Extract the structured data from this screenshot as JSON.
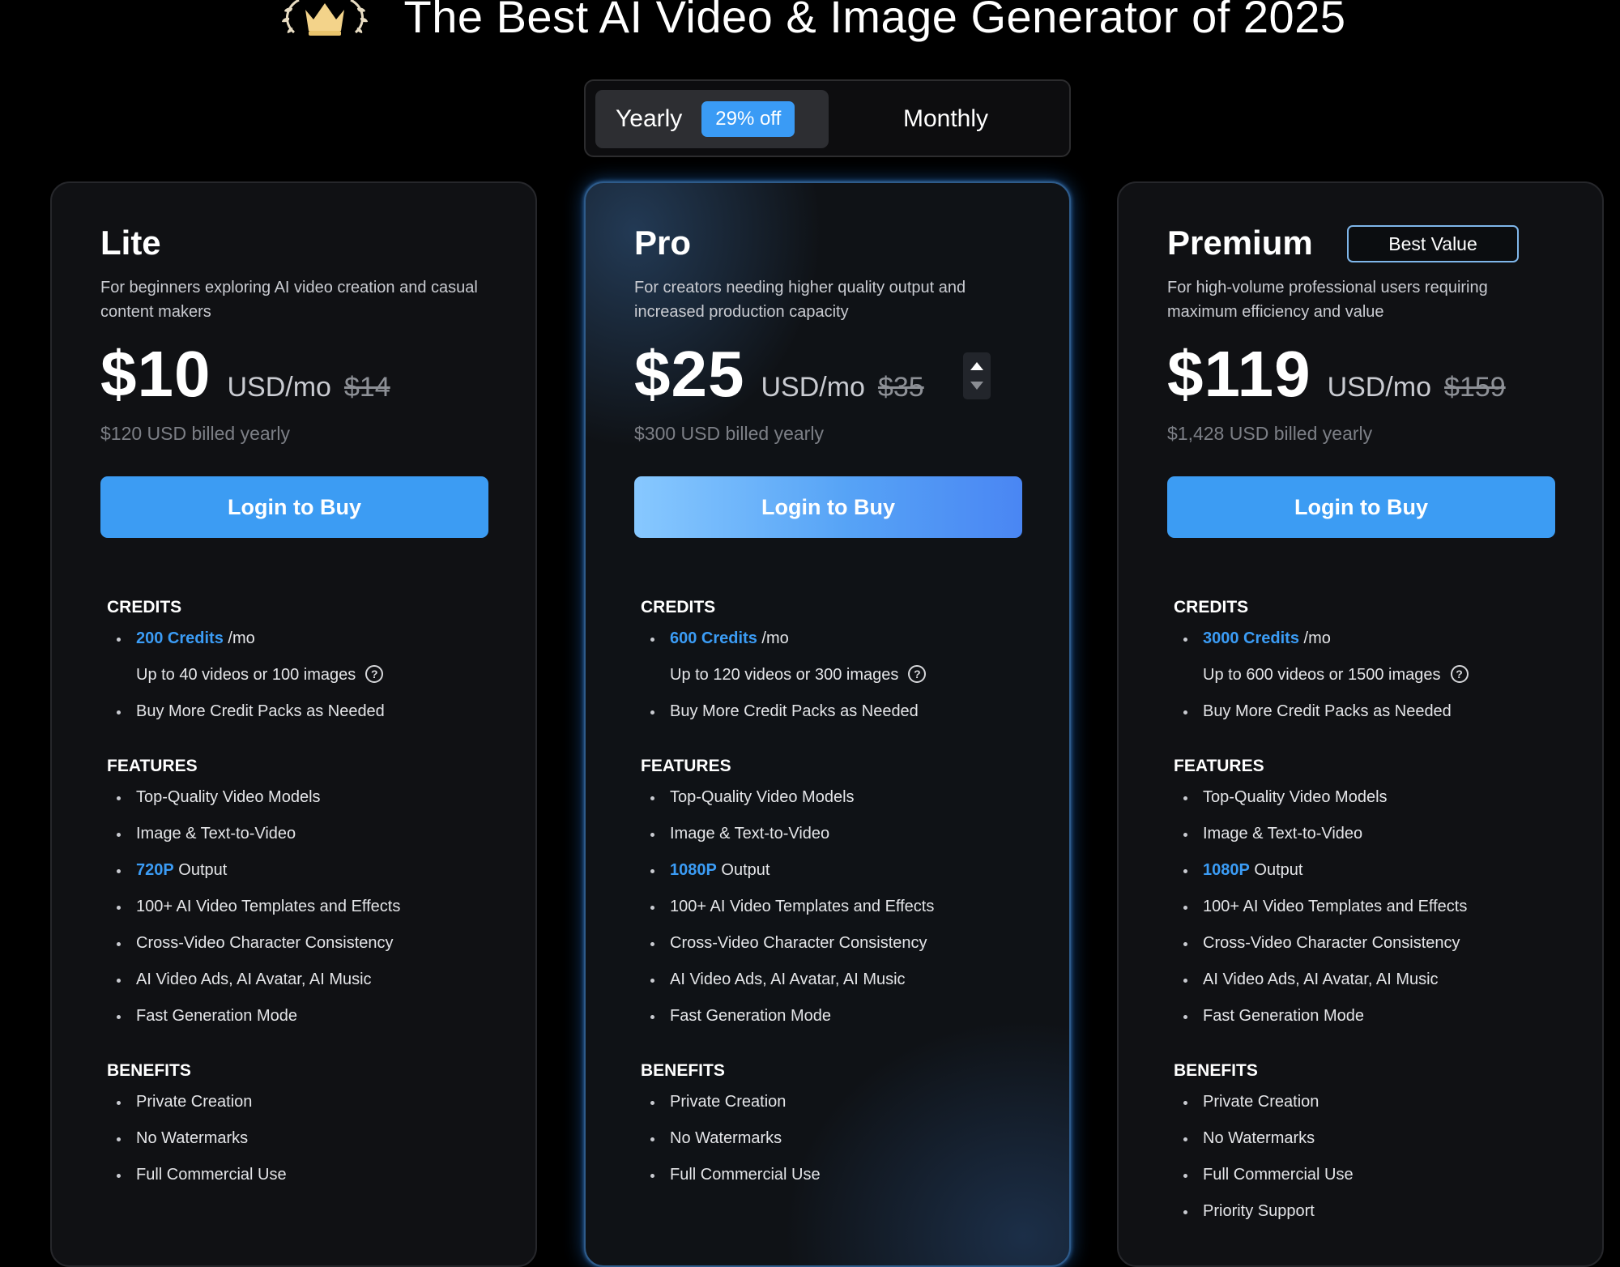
{
  "header": {
    "title": "The Best AI Video & Image Generator of 2025"
  },
  "billing_toggle": {
    "yearly_label": "Yearly",
    "discount_badge": "29% off",
    "monthly_label": "Monthly",
    "selected": "Yearly"
  },
  "colors": {
    "accent": "#3b9cf5",
    "button": "#3c9cf3",
    "background": "#000000",
    "card": "#101114"
  },
  "icons": [
    "crown-laurel-icon",
    "help-circle-icon",
    "stepper-up-icon",
    "stepper-down-icon"
  ],
  "plans": [
    {
      "name": "Lite",
      "description": "For beginners exploring AI video creation and casual content makers",
      "price": "$10",
      "unit": "USD/mo",
      "old_price": "$14",
      "billed": "$120 USD billed yearly",
      "button": "Login to Buy",
      "credits_title": "CREDITS",
      "credits_highlight": "200 Credits",
      "credits_suffix": " /mo",
      "credits_note": "Up to 40 videos or 100 images",
      "credits_more": "Buy More Credit Packs as Needed",
      "features_title": "FEATURES",
      "features": {
        "f1": "Top-Quality Video Models",
        "f2": "Image & Text-to-Video",
        "res_highlight": "720P",
        "res_suffix": " Output",
        "f4": "100+ AI Video Templates and Effects",
        "f5": "Cross-Video Character Consistency",
        "f6": "AI Video Ads, AI Avatar, AI Music",
        "f7": "Fast Generation Mode"
      },
      "benefits_title": "BENEFITS",
      "benefits": [
        "Private Creation",
        "No Watermarks",
        "Full Commercial Use"
      ]
    },
    {
      "name": "Pro",
      "description": "For creators needing higher quality output and increased production capacity",
      "price": "$25",
      "unit": "USD/mo",
      "old_price": "$35",
      "billed": "$300 USD billed yearly",
      "button": "Login to Buy",
      "credits_title": "CREDITS",
      "credits_highlight": "600 Credits",
      "credits_suffix": " /mo",
      "credits_note": "Up to 120 videos or 300 images",
      "credits_more": "Buy More Credit Packs as Needed",
      "features_title": "FEATURES",
      "features": {
        "f1": "Top-Quality Video Models",
        "f2": "Image & Text-to-Video",
        "res_highlight": "1080P",
        "res_suffix": " Output",
        "f4": "100+ AI Video Templates and Effects",
        "f5": "Cross-Video Character Consistency",
        "f6": "AI Video Ads, AI Avatar, AI Music",
        "f7": "Fast Generation Mode"
      },
      "benefits_title": "BENEFITS",
      "benefits": [
        "Private Creation",
        "No Watermarks",
        "Full Commercial Use"
      ]
    },
    {
      "name": "Premium",
      "badge": "Best Value",
      "description": "For high-volume professional users requiring maximum efficiency and value",
      "price": "$119",
      "unit": "USD/mo",
      "old_price": "$159",
      "billed": "$1,428 USD billed yearly",
      "button": "Login to Buy",
      "credits_title": "CREDITS",
      "credits_highlight": "3000 Credits",
      "credits_suffix": " /mo",
      "credits_note": "Up to 600 videos or 1500 images",
      "credits_more": "Buy More Credit Packs as Needed",
      "features_title": "FEATURES",
      "features": {
        "f1": "Top-Quality Video Models",
        "f2": "Image & Text-to-Video",
        "res_highlight": "1080P",
        "res_suffix": " Output",
        "f4": "100+ AI Video Templates and Effects",
        "f5": "Cross-Video Character Consistency",
        "f6": "AI Video Ads, AI Avatar, AI Music",
        "f7": "Fast Generation Mode"
      },
      "benefits_title": "BENEFITS",
      "benefits": [
        "Private Creation",
        "No Watermarks",
        "Full Commercial Use",
        "Priority Support"
      ]
    }
  ]
}
